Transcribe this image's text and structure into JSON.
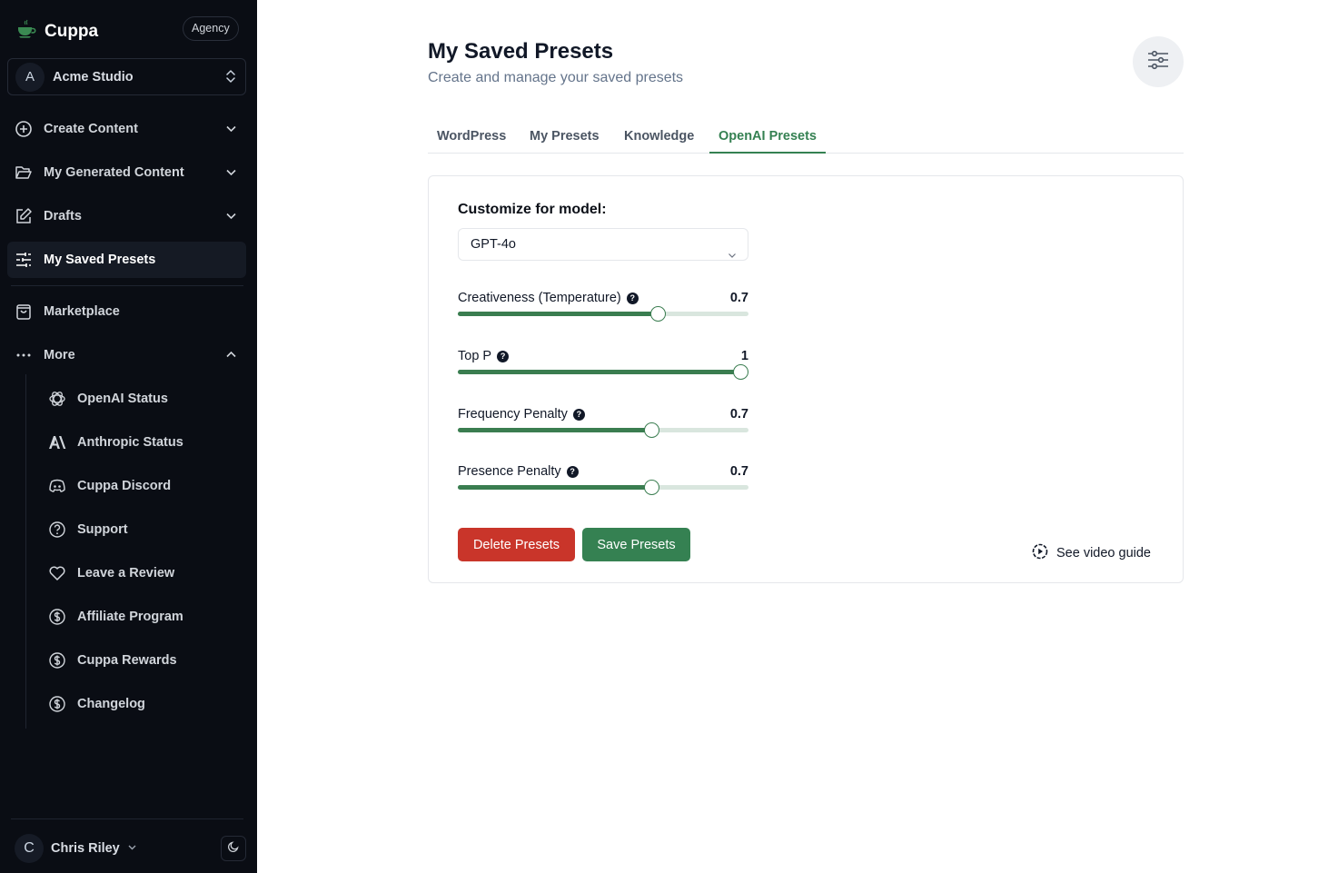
{
  "sidebar": {
    "brand": "Cuppa",
    "plan_badge": "Agency",
    "workspace": {
      "initial": "A",
      "name": "Acme Studio"
    },
    "nav": [
      {
        "label": "Create Content",
        "icon": "plus-circle-icon",
        "expandable": true
      },
      {
        "label": "My Generated Content",
        "icon": "folder-open-icon",
        "expandable": true
      },
      {
        "label": "Drafts",
        "icon": "edit-icon",
        "expandable": true
      },
      {
        "label": "My Saved Presets",
        "icon": "sliders-icon",
        "active": true
      },
      {
        "label": "Marketplace",
        "icon": "shopping-bag-icon"
      },
      {
        "label": "More",
        "icon": "more-dots-icon",
        "expanded": true
      }
    ],
    "more_items": [
      {
        "label": "OpenAI Status",
        "icon": "openai-icon"
      },
      {
        "label": "Anthropic Status",
        "icon": "anthropic-icon"
      },
      {
        "label": "Cuppa Discord",
        "icon": "discord-icon"
      },
      {
        "label": "Support",
        "icon": "help-circle-icon"
      },
      {
        "label": "Leave a Review",
        "icon": "heart-icon"
      },
      {
        "label": "Affiliate Program",
        "icon": "dollar-circle-icon"
      },
      {
        "label": "Cuppa Rewards",
        "icon": "dollar-circle-icon"
      },
      {
        "label": "Changelog",
        "icon": "dollar-circle-icon"
      }
    ],
    "user": {
      "initial": "C",
      "name": "Chris Riley"
    }
  },
  "header": {
    "title": "My Saved Presets",
    "subtitle": "Create and manage your saved presets"
  },
  "tabs": [
    {
      "label": "WordPress"
    },
    {
      "label": "My Presets"
    },
    {
      "label": "Knowledge"
    },
    {
      "label": "OpenAI Presets",
      "active": true
    }
  ],
  "form": {
    "model_label": "Customize for model:",
    "model_value": "GPT-4o",
    "sliders": [
      {
        "label": "Creativeness (Temperature)",
        "value": 0.7,
        "display": "0.7",
        "min": 0,
        "max": 1
      },
      {
        "label": "Top P",
        "value": 1,
        "display": "1",
        "min": 0,
        "max": 1
      },
      {
        "label": "Frequency Penalty",
        "value": 0.7,
        "display": "0.7",
        "min": -2,
        "max": 2
      },
      {
        "label": "Presence Penalty",
        "value": 0.7,
        "display": "0.7",
        "min": -2,
        "max": 2
      }
    ],
    "delete_label": "Delete Presets",
    "save_label": "Save Presets",
    "video_guide_label": "See video guide"
  },
  "colors": {
    "accent": "#358152",
    "danger": "#c9352a",
    "sidebar_bg": "#0a0d14"
  }
}
